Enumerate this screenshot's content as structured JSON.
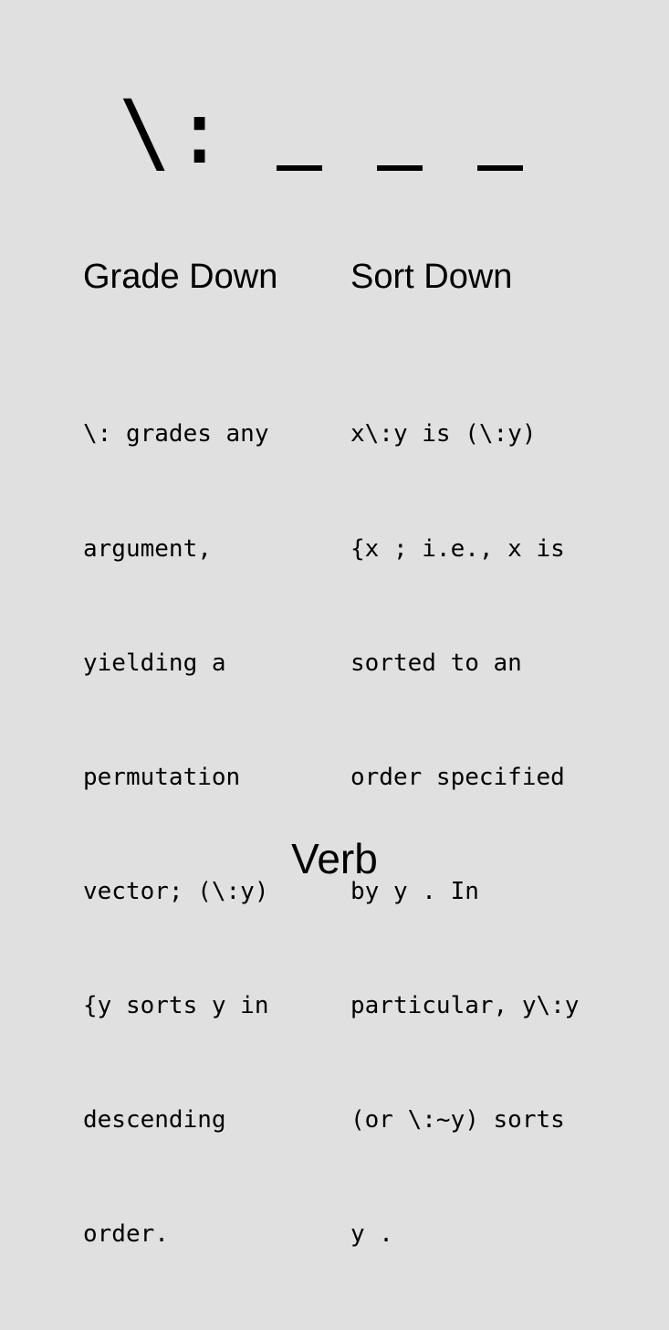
{
  "symbol": "\\:",
  "monad": {
    "heading": "Grade Down",
    "lines": [
      "\\: grades any",
      "argument,",
      "yielding a",
      "permutation",
      "vector; (\\:y)",
      "{y sorts y in",
      "descending",
      "order."
    ]
  },
  "dyad": {
    "heading": "Sort Down",
    "lines": [
      "x\\:y is (\\:y)",
      "{x ; i.e., x is",
      "sorted to an",
      "order specified",
      "by y . In",
      "particular, y\\:y",
      "(or \\:~y) sorts",
      "y ."
    ]
  },
  "part_of_speech": "Verb"
}
